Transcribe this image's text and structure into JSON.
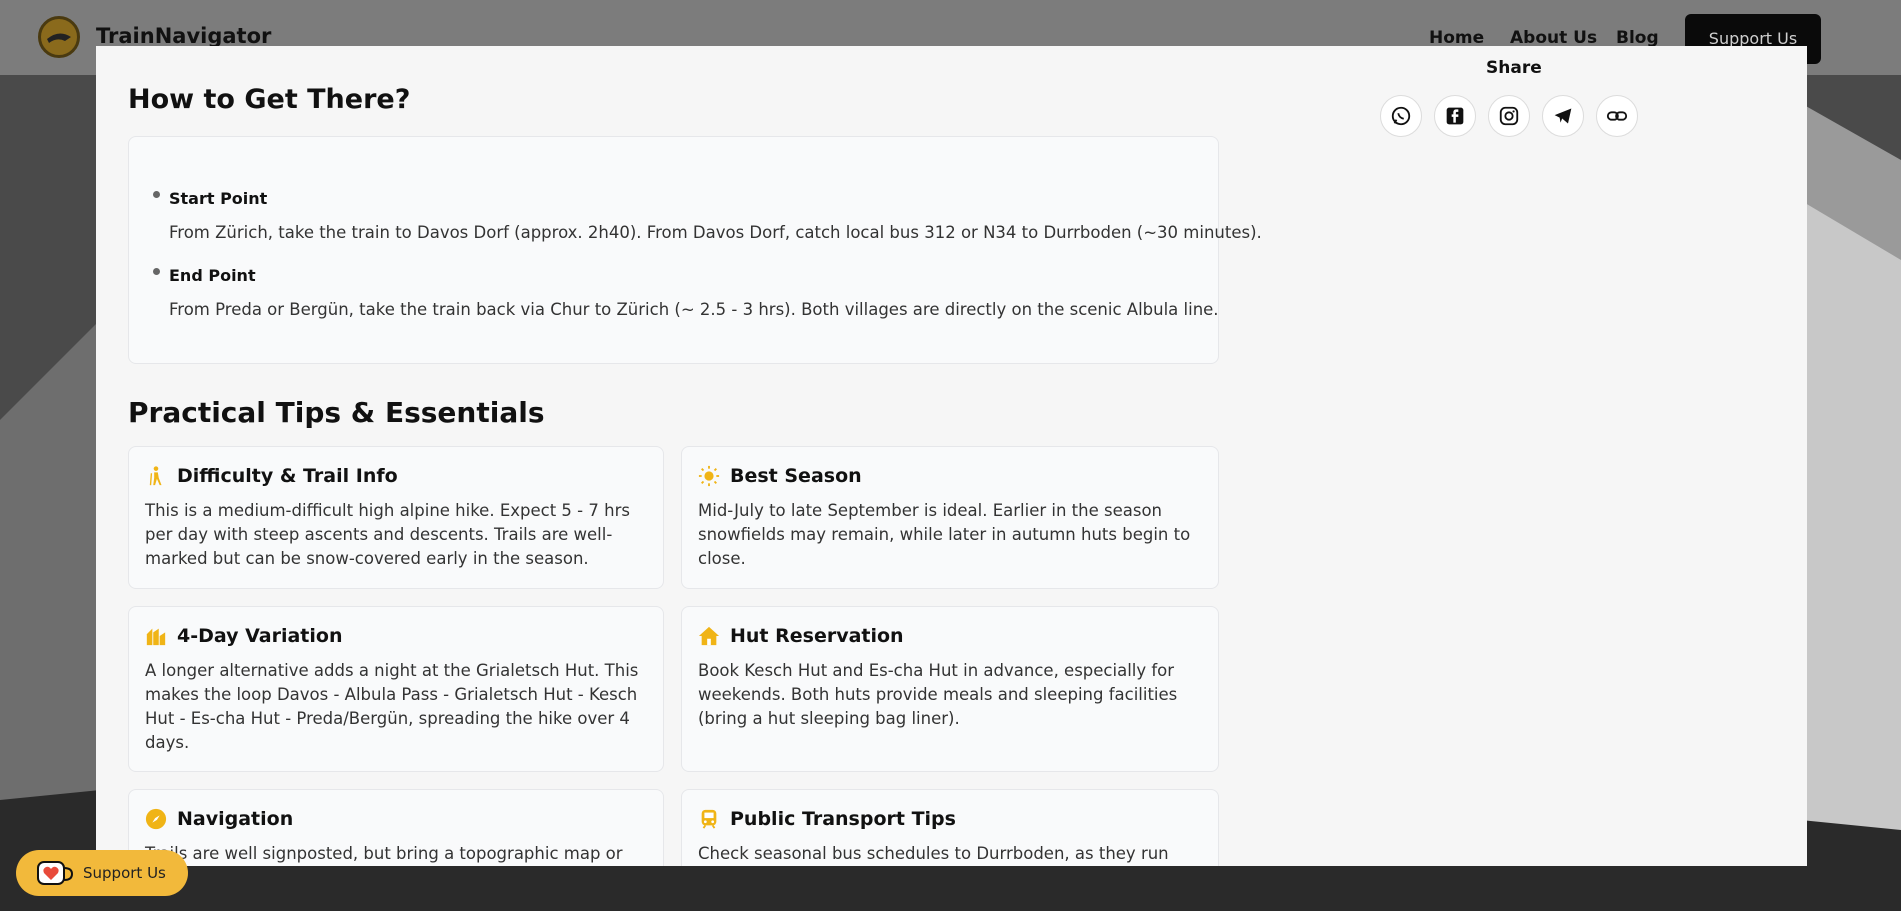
{
  "header": {
    "brand": "TrainNavigator",
    "nav": [
      {
        "label": "Home"
      },
      {
        "label": "About Us"
      },
      {
        "label": "Blog"
      }
    ],
    "support_label": "Support Us"
  },
  "share": {
    "title": "Share",
    "buttons": [
      {
        "icon": "whatsapp-icon"
      },
      {
        "icon": "facebook-icon"
      },
      {
        "icon": "instagram-icon"
      },
      {
        "icon": "telegram-icon"
      },
      {
        "icon": "link-icon"
      }
    ]
  },
  "how_to": {
    "title": "How to Get There?",
    "points": [
      {
        "title": "Start Point",
        "text": "From Zürich, take the train to Davos Dorf (approx. 2h40). From Davos Dorf, catch local bus 312 or N34 to Durrboden (~30 minutes)."
      },
      {
        "title": "End Point",
        "text": "From Preda or Bergün, take the train back via Chur to Zürich (~ 2.5 - 3 hrs). Both villages are directly on the scenic Albula line."
      }
    ]
  },
  "tips": {
    "title": "Practical Tips & Essentials",
    "cards": [
      {
        "icon": "hiker-icon",
        "title": "Difficulty & Trail Info",
        "text": "This is a medium-difficult high alpine hike. Expect 5 - 7 hrs per day with steep ascents and descents. Trails are well-marked but can be snow-covered early in the season."
      },
      {
        "icon": "sun-icon",
        "title": "Best Season",
        "text": "Mid-July to late September is ideal. Earlier in the season snowfields may remain, while later in autumn huts begin to close."
      },
      {
        "icon": "hotel-icon",
        "title": "4-Day Variation",
        "text": "A longer alternative adds a night at the Grialetsch Hut. This makes the loop Davos - Albula Pass - Grialetsch Hut - Kesch Hut - Es-cha Hut - Preda/Bergün, spreading the hike over 4 days."
      },
      {
        "icon": "house-icon",
        "title": "Hut Reservation",
        "text": "Book Kesch Hut and Es-cha Hut in advance, especially for weekends. Both huts provide meals and sleeping facilities (bring a hut sleeping bag liner)."
      },
      {
        "icon": "compass-icon",
        "title": "Navigation",
        "text": "Trails are well signposted, but bring a topographic map or"
      },
      {
        "icon": "train-icon",
        "title": "Public Transport Tips",
        "text": "Check seasonal bus schedules to Durrboden, as they run"
      }
    ]
  },
  "floating_support": {
    "label": "Support Us"
  },
  "colors": {
    "accent": "#f2b93b",
    "icon_yellow": "#f0b416",
    "panel": "#f6f6f6"
  }
}
